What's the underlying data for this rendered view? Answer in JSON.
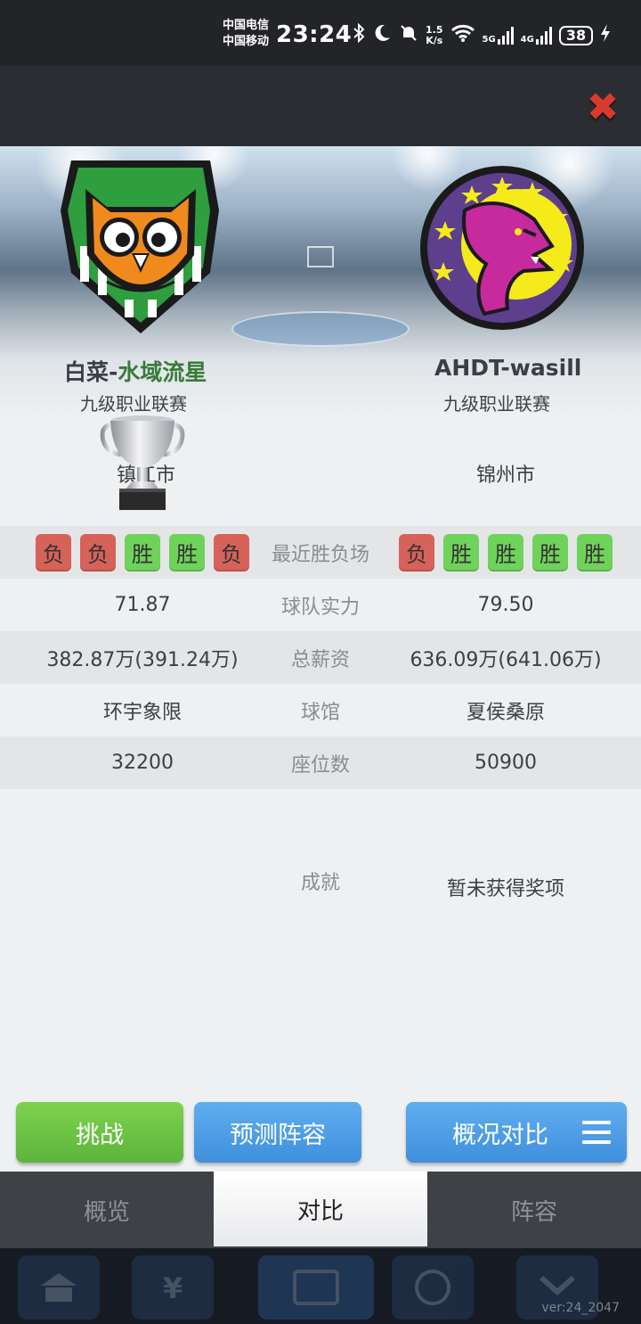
{
  "status_bar": {
    "carrier_1": "中国电信",
    "carrier_2": "中国移动",
    "time": "23:24",
    "net_speed_value": "1.5",
    "net_speed_unit": "K/s",
    "signal_1": "5G",
    "signal_2": "4G",
    "battery": "38",
    "icons": [
      "bluetooth-icon",
      "moon-icon",
      "bell-muted-icon",
      "wifi-icon",
      "signal-icon",
      "charging-icon"
    ]
  },
  "colors": {
    "lose": "#d7625a",
    "win": "#6fd25b",
    "challenge_button": "#5bb43a",
    "blue_button": "#3f8fdc",
    "close": "#d93a2c"
  },
  "home": {
    "name_prefix": "白菜-",
    "name_suffix": "水域流星",
    "league": "九级职业联赛",
    "city": "镇江市",
    "recent": [
      "负",
      "负",
      "胜",
      "胜",
      "负"
    ],
    "strength": "71.87",
    "salary": "382.87万(391.24万)",
    "arena": "环宇象限",
    "seats": "32200",
    "achievement_icon": "trophy-icon"
  },
  "away": {
    "name": "AHDT-wasill",
    "league": "九级职业联赛",
    "city": "锦州市",
    "recent": [
      "负",
      "胜",
      "胜",
      "胜",
      "胜"
    ],
    "strength": "79.50",
    "salary": "636.09万(641.06万)",
    "arena": "夏侯桑原",
    "seats": "50900",
    "achievement": "暂未获得奖项"
  },
  "labels": {
    "recent": "最近胜负场",
    "strength": "球队实力",
    "salary": "总薪资",
    "arena": "球馆",
    "seats": "座位数",
    "achievement": "成就"
  },
  "buttons": {
    "challenge": "挑战",
    "predict": "预测阵容",
    "compare": "概况对比"
  },
  "tabs": [
    "概览",
    "对比",
    "阵容"
  ],
  "active_tab": 1,
  "version": "ver:24_2047"
}
